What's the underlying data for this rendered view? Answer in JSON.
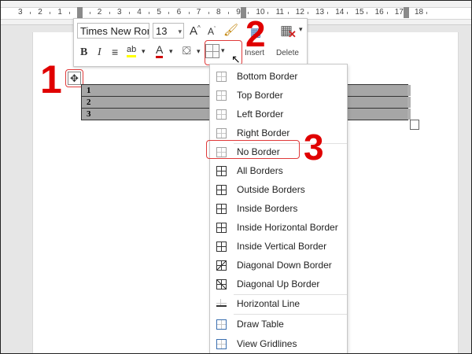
{
  "ruler": {
    "numbers": [
      "3",
      "2",
      "1",
      "1",
      "2",
      "3",
      "4",
      "5",
      "6",
      "7",
      "8",
      "9",
      "10",
      "11",
      "12",
      "13",
      "14",
      "15",
      "16",
      "17",
      "18"
    ]
  },
  "doc_table": {
    "rows": [
      "1",
      "2",
      "3"
    ]
  },
  "mini_toolbar": {
    "font_name": "Times New Ron",
    "font_size": "13",
    "grow_font": "A",
    "shrink_font": "A",
    "bold": "B",
    "italic": "I",
    "font_color_glyph": "A",
    "insert_label": "Insert",
    "delete_label": "Delete"
  },
  "callouts": {
    "one": "1",
    "two": "2",
    "three": "3"
  },
  "menu": {
    "items": [
      {
        "label": "Bottom Border",
        "icon": "border-bottom-icon"
      },
      {
        "label": "Top Border",
        "icon": "border-top-icon"
      },
      {
        "label": "Left Border",
        "icon": "border-left-icon"
      },
      {
        "label": "Right Border",
        "icon": "border-right-icon"
      },
      {
        "label": "No Border",
        "icon": "border-none-icon"
      },
      {
        "label": "All Borders",
        "icon": "border-all-icon"
      },
      {
        "label": "Outside Borders",
        "icon": "border-outside-icon"
      },
      {
        "label": "Inside Borders",
        "icon": "border-inside-icon"
      },
      {
        "label": "Inside Horizontal Border",
        "icon": "border-inside-horizontal-icon"
      },
      {
        "label": "Inside Vertical Border",
        "icon": "border-inside-vertical-icon"
      },
      {
        "label": "Diagonal Down Border",
        "icon": "border-diagonal-down-icon"
      },
      {
        "label": "Diagonal Up Border",
        "icon": "border-diagonal-up-icon"
      },
      {
        "label": "Horizontal Line",
        "icon": "horizontal-line-icon"
      },
      {
        "label": "Draw Table",
        "icon": "draw-table-icon"
      },
      {
        "label": "View Gridlines",
        "icon": "view-gridlines-icon"
      }
    ]
  },
  "colors": {
    "accent_red": "#e00000",
    "highlight_yellow": "#ffff00",
    "font_red": "#d00000"
  }
}
